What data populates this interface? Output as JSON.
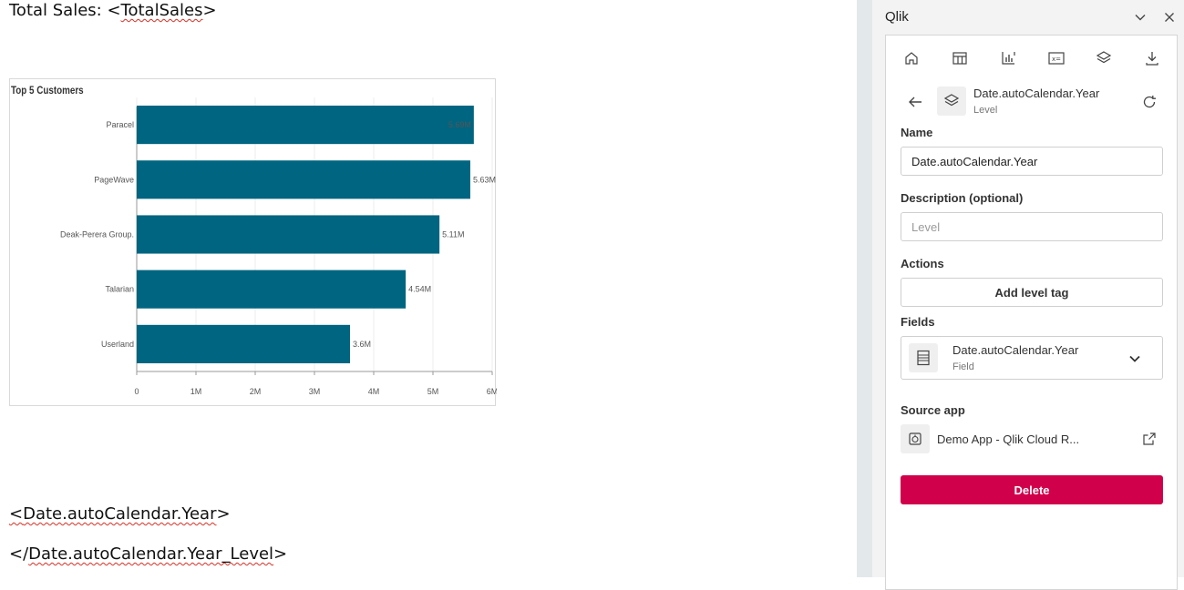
{
  "document": {
    "total_sales_label": "Total Sales: <",
    "total_sales_field": "TotalSales",
    "total_sales_close": ">",
    "year_open": "<",
    "year_field": "Date.autoCalendar.Year",
    "year_close": ">",
    "level_open": "</",
    "level_field": "Date.autoCalendar.Year_Level",
    "level_close": ">"
  },
  "chart_data": {
    "type": "bar",
    "orientation": "horizontal",
    "title": "Top 5 Customers",
    "categories": [
      "Paracel",
      "PageWave",
      "Deak-Perera Group.",
      "Talarian",
      "Userland"
    ],
    "values": [
      5.69,
      5.63,
      5.11,
      4.54,
      3.6
    ],
    "data_labels": [
      "5.69M",
      "5.63M",
      "5.11M",
      "4.54M",
      "3.6M"
    ],
    "x_ticks": [
      "0",
      "1M",
      "2M",
      "3M",
      "4M",
      "5M",
      "6M"
    ],
    "xlim": [
      0,
      6
    ],
    "bar_color": "#006580",
    "grid": true
  },
  "panel": {
    "title": "Qlik",
    "header_icons": [
      "chevron-down-icon",
      "close-icon"
    ],
    "toolbar": [
      "home-icon",
      "table-icon",
      "chart-icon",
      "variable-icon",
      "layers-icon",
      "download-icon"
    ],
    "item": {
      "title": "Date.autoCalendar.Year",
      "subtitle": "Level"
    },
    "name_label": "Name",
    "name_value": "Date.autoCalendar.Year",
    "description_label": "Description (optional)",
    "description_placeholder": "Level",
    "actions_label": "Actions",
    "add_level_tag": "Add level tag",
    "fields_label": "Fields",
    "field": {
      "title": "Date.autoCalendar.Year",
      "subtitle": "Field"
    },
    "source_app_label": "Source app",
    "source_app_name": "Demo App - Qlik Cloud R...",
    "delete_label": "Delete",
    "accent": "#d1004a"
  }
}
